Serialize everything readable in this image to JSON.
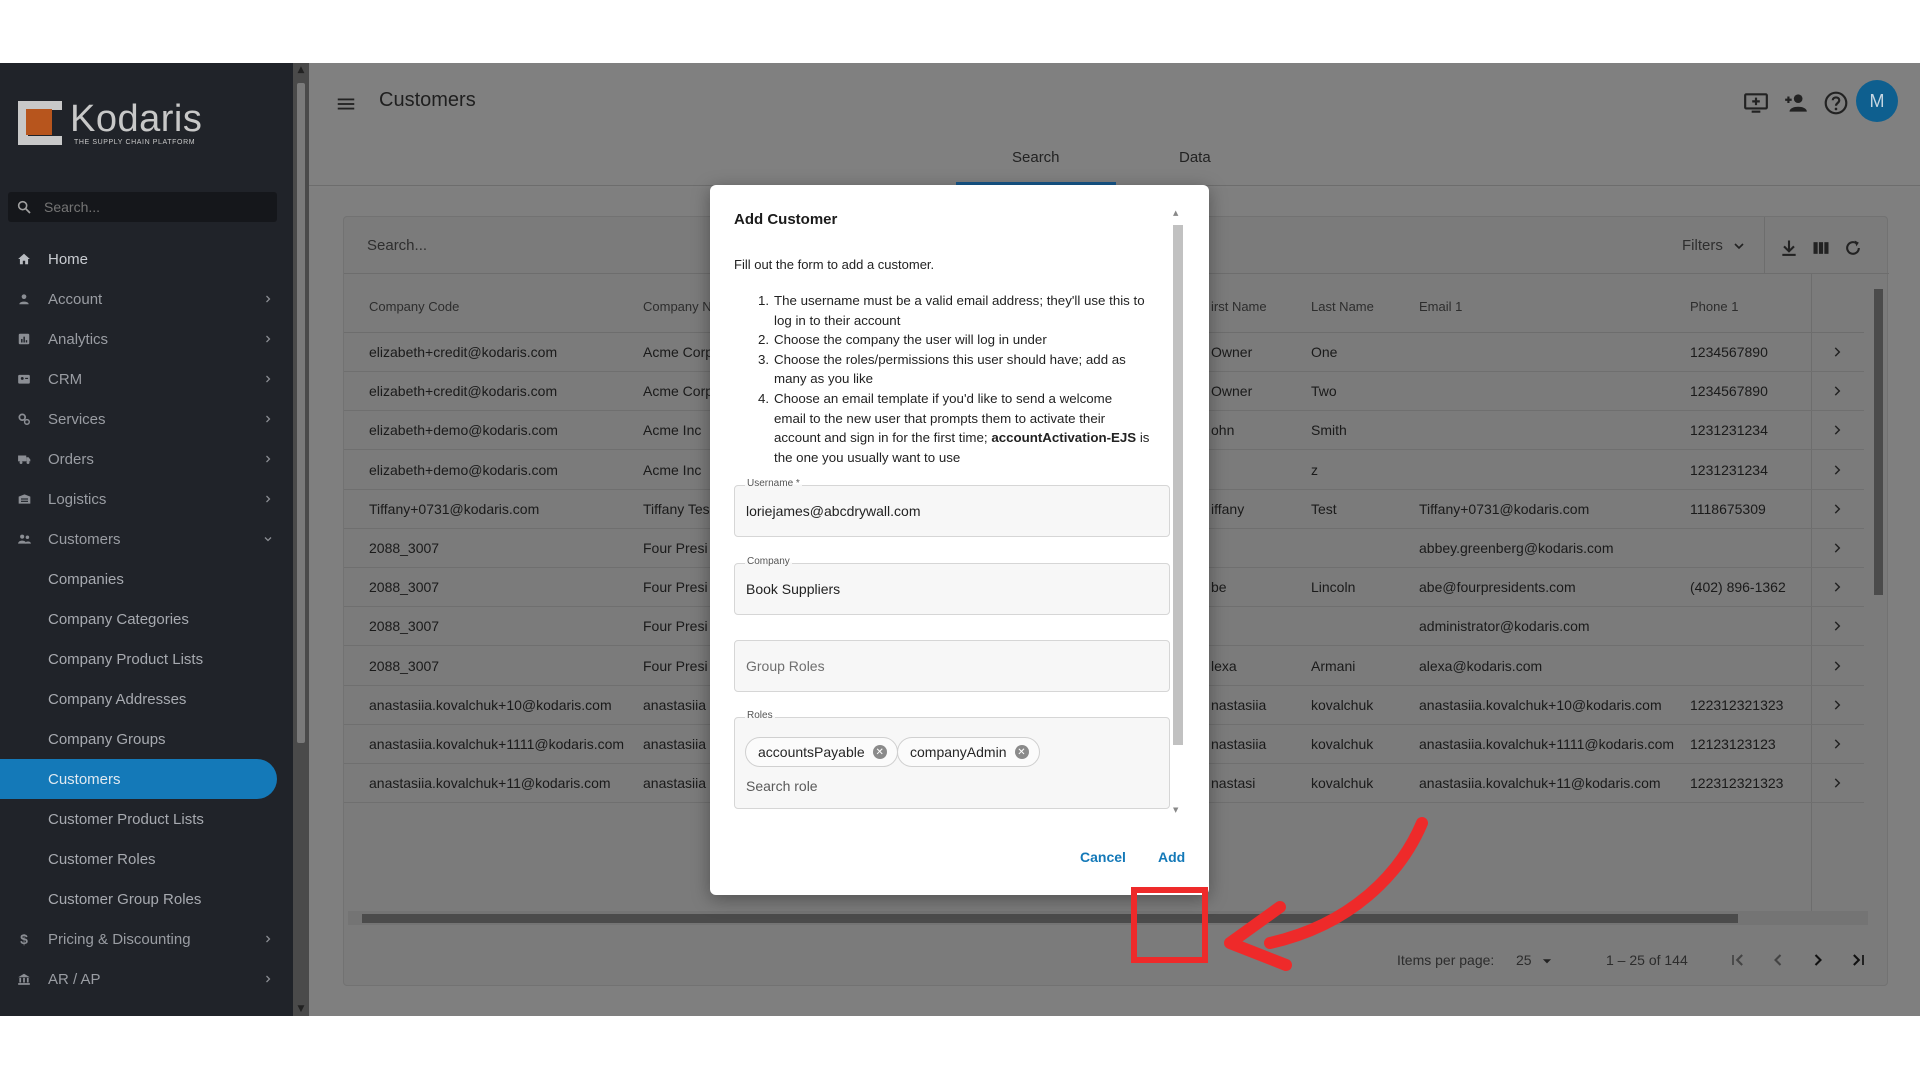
{
  "brand": {
    "name": "Kodaris",
    "tagline": "THE SUPPLY CHAIN PLATFORM"
  },
  "sidebar": {
    "search_placeholder": "Search...",
    "items": [
      {
        "label": "Home",
        "icon": "home-icon"
      },
      {
        "label": "Account",
        "icon": "account-icon"
      },
      {
        "label": "Analytics",
        "icon": "analytics-icon"
      },
      {
        "label": "CRM",
        "icon": "crm-icon"
      },
      {
        "label": "Services",
        "icon": "services-icon"
      },
      {
        "label": "Orders",
        "icon": "orders-icon"
      },
      {
        "label": "Logistics",
        "icon": "logistics-icon"
      },
      {
        "label": "Customers",
        "icon": "customers-icon"
      }
    ],
    "sub_items": [
      "Companies",
      "Company Categories",
      "Company Product Lists",
      "Company Addresses",
      "Company Groups",
      "Customers",
      "Customer Product Lists",
      "Customer Roles",
      "Customer Group Roles"
    ],
    "bottom_items": [
      {
        "label": "Pricing & Discounting",
        "icon": "dollar-icon"
      },
      {
        "label": "AR / AP",
        "icon": "bank-icon"
      }
    ],
    "active": "Customers"
  },
  "header": {
    "title": "Customers",
    "avatar_initial": "M"
  },
  "tabs": [
    {
      "label": "Search"
    },
    {
      "label": "Data"
    }
  ],
  "toolbar": {
    "search_placeholder": "Search...",
    "filters_label": "Filters"
  },
  "table": {
    "columns": [
      "Company Code",
      "Company Na",
      "irst Name",
      "Last Name",
      "Email 1",
      "Phone 1"
    ],
    "rows": [
      [
        "elizabeth+credit@kodaris.com",
        "Acme Corp",
        "Owner",
        "One",
        "",
        "1234567890"
      ],
      [
        "elizabeth+credit@kodaris.com",
        "Acme Corp",
        "Owner",
        "Two",
        "",
        "1234567890"
      ],
      [
        "elizabeth+demo@kodaris.com",
        "Acme Inc",
        "ohn",
        "Smith",
        "",
        "1231231234"
      ],
      [
        "elizabeth+demo@kodaris.com",
        "Acme Inc",
        "",
        "z",
        "",
        "1231231234"
      ],
      [
        "Tiffany+0731@kodaris.com",
        "Tiffany Tes",
        "iffany",
        "Test",
        "Tiffany+0731@kodaris.com",
        "1118675309"
      ],
      [
        "2088_3007",
        "Four Presi",
        "",
        "",
        "abbey.greenberg@kodaris.com",
        ""
      ],
      [
        "2088_3007",
        "Four Presi",
        "be",
        "Lincoln",
        "abe@fourpresidents.com",
        "(402) 896-1362"
      ],
      [
        "2088_3007",
        "Four Presi",
        "",
        "",
        "administrator@kodaris.com",
        ""
      ],
      [
        "2088_3007",
        "Four Presi",
        "lexa",
        "Armani",
        "alexa@kodaris.com",
        ""
      ],
      [
        "anastasiia.kovalchuk+10@kodaris.com",
        "anastasiia",
        "nastasiia",
        "kovalchuk",
        "anastasiia.kovalchuk+10@kodaris.com",
        "122312321323"
      ],
      [
        "anastasiia.kovalchuk+1111@kodaris.com",
        "anastasiia",
        "nastasiia",
        "kovalchuk",
        "anastasiia.kovalchuk+1111@kodaris.com",
        "12123123123"
      ],
      [
        "anastasiia.kovalchuk+11@kodaris.com",
        "anastasiia",
        "nastasi",
        "kovalchuk",
        "anastasiia.kovalchuk+11@kodaris.com",
        "122312321323"
      ]
    ]
  },
  "pagination": {
    "items_per_page_label": "Items per page:",
    "items_per_page": "25",
    "range": "1 – 25 of 144"
  },
  "modal": {
    "title": "Add Customer",
    "intro": "Fill out the form to add a customer.",
    "steps": [
      {
        "num": "1.",
        "lines": [
          "The username must be a valid email address; they'll use this to",
          "log in to their account"
        ]
      },
      {
        "num": "2.",
        "lines": [
          "Choose the company the user will log in under"
        ]
      },
      {
        "num": "3.",
        "lines": [
          "Choose the roles/permissions this user should have; add as",
          "many as you like"
        ]
      },
      {
        "num": "4.",
        "lines": [
          "Choose an email template if you'd like to send a welcome",
          "email to the new user that prompts them to activate their",
          "account and sign in for the first time;",
          "the one you usually want to use"
        ],
        "bold": "accountActivation-EJS",
        "after_bold": " is"
      }
    ],
    "username_label": "Username *",
    "username_value": "loriejames@abcdrywall.com",
    "company_label": "Company",
    "company_value": "Book Suppliers",
    "group_roles_placeholder": "Group Roles",
    "roles_label": "Roles",
    "roles": [
      "accountsPayable",
      "companyAdmin"
    ],
    "roles_search_placeholder": "Search role",
    "cancel_label": "Cancel",
    "add_label": "Add"
  },
  "colors": {
    "accent": "#1479b8",
    "annotation": "#ee2a2a",
    "brand_orange": "#b7551d"
  }
}
